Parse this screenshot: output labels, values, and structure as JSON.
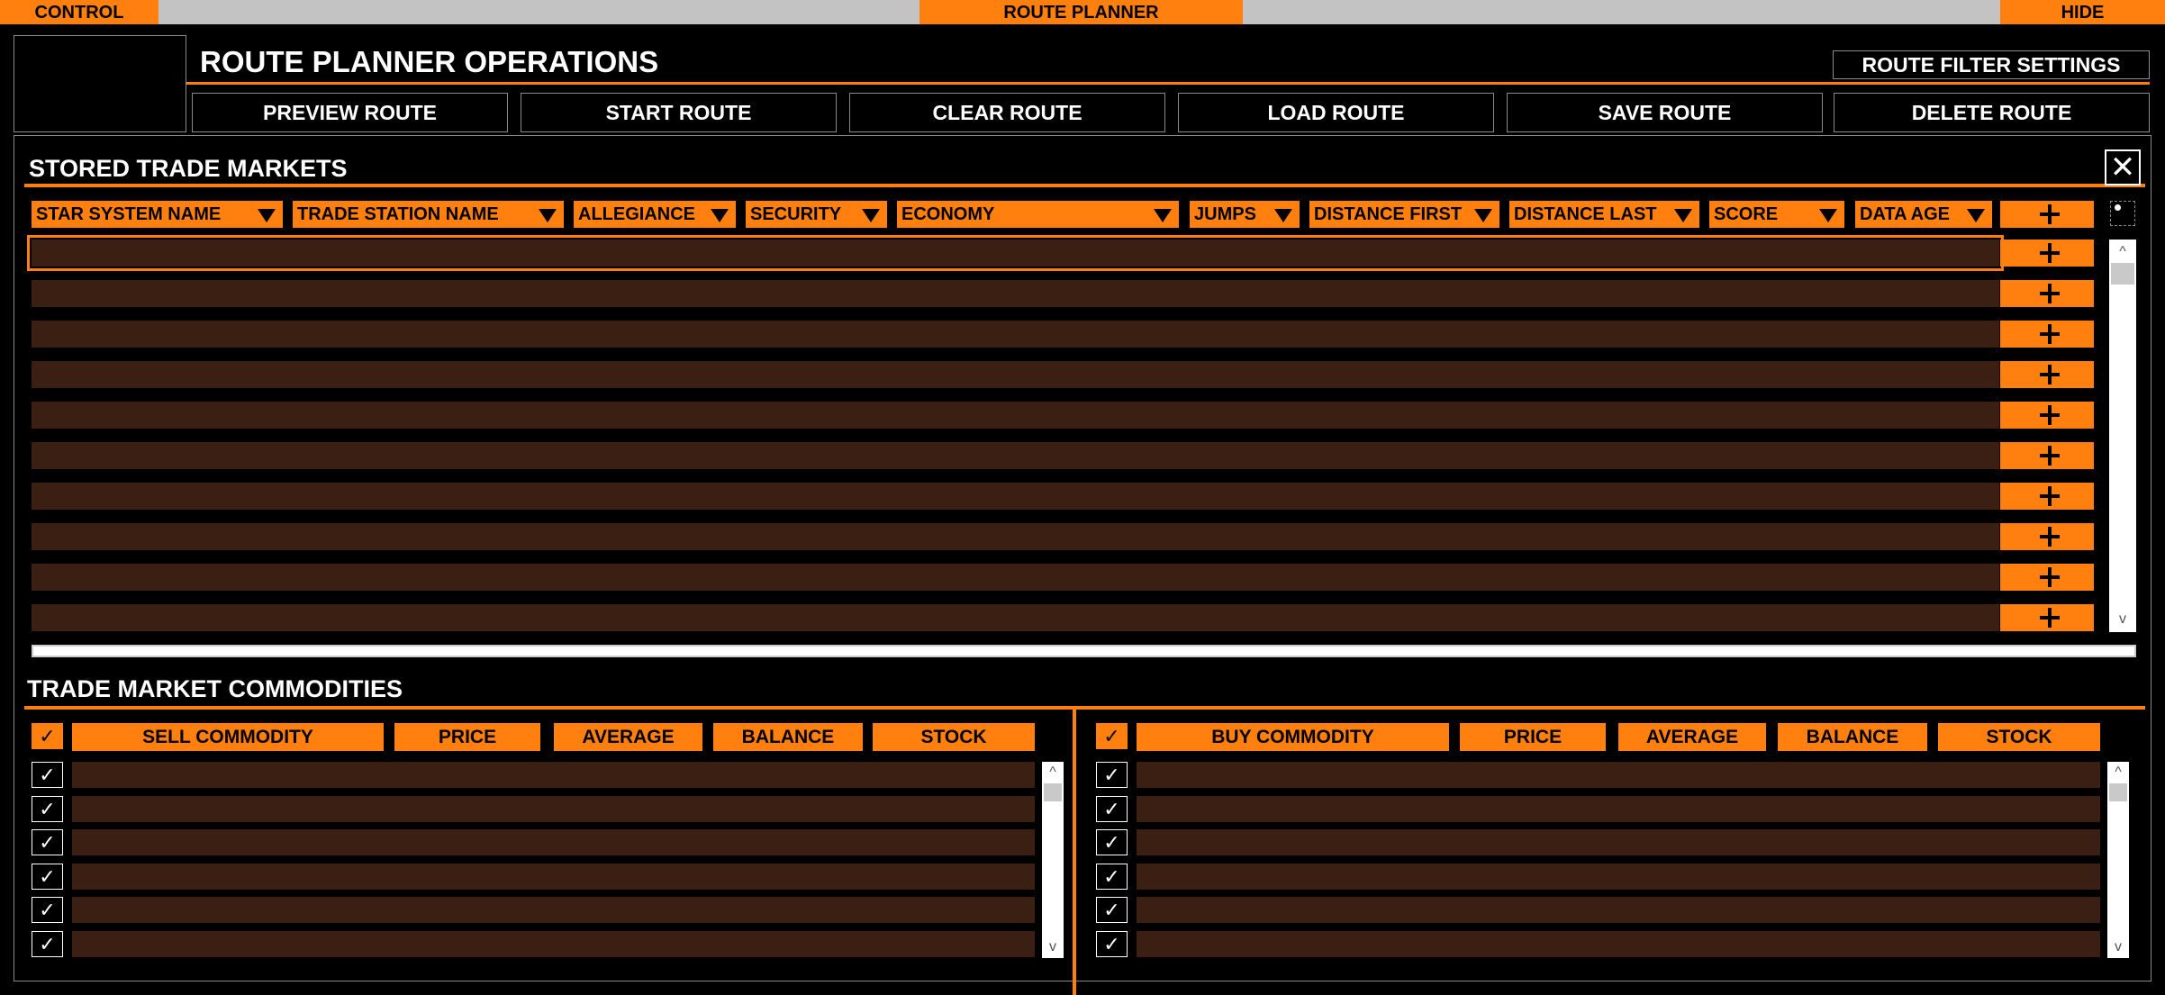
{
  "top_tabs": {
    "control": "CONTROL",
    "route_planner": "ROUTE PLANNER",
    "hide": "HIDE"
  },
  "header": {
    "title": "ROUTE PLANNER OPERATIONS",
    "filter_button": "ROUTE FILTER SETTINGS",
    "actions": [
      "PREVIEW ROUTE",
      "START ROUTE",
      "CLEAR ROUTE",
      "LOAD ROUTE",
      "SAVE ROUTE",
      "DELETE ROUTE"
    ]
  },
  "markets": {
    "title": "STORED TRADE MARKETS",
    "columns": [
      "STAR SYSTEM NAME",
      "TRADE STATION NAME",
      "ALLEGIANCE",
      "SECURITY",
      "ECONOMY",
      "JUMPS",
      "DISTANCE FIRST",
      "DISTANCE LAST",
      "SCORE",
      "DATA AGE"
    ]
  },
  "commodities": {
    "title": "TRADE MARKET COMMODITIES",
    "sell_columns": [
      "SELL COMMODITY",
      "PRICE",
      "AVERAGE",
      "BALANCE",
      "STOCK"
    ],
    "buy_columns": [
      "BUY COMMODITY",
      "PRICE",
      "AVERAGE",
      "BALANCE",
      "STOCK"
    ]
  },
  "glyphs": {
    "check": "✓",
    "close": "✕",
    "up": "^",
    "down": "v"
  },
  "colors": {
    "accent": "#ff7f0f",
    "row": "#3a1f12",
    "background": "#000000"
  }
}
